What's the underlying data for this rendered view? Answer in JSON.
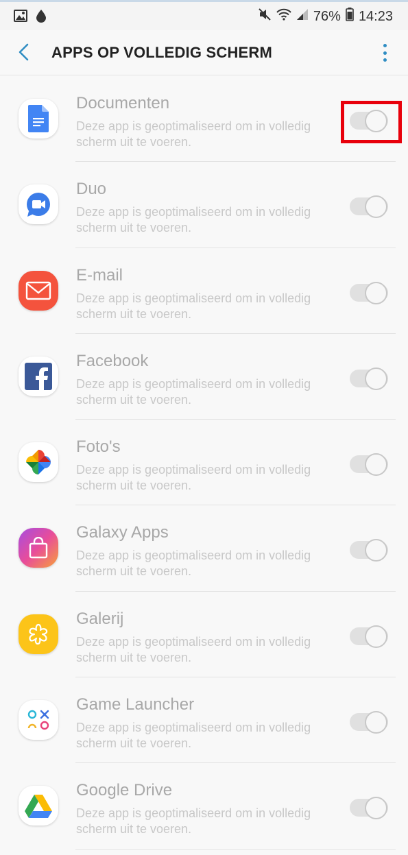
{
  "status_bar": {
    "battery": "76%",
    "time": "14:23",
    "icons": [
      "image-icon",
      "drop-icon",
      "mute-icon",
      "wifi-icon",
      "signal-icon",
      "battery-icon"
    ]
  },
  "app_bar": {
    "title": "APPS OP VOLLEDIG SCHERM",
    "back_icon": "back-arrow-icon",
    "more_icon": "more-vert-icon"
  },
  "colors": {
    "accent": "#2f8dc3",
    "highlight": "#e8000b",
    "disabled_title": "#a8a8a8",
    "disabled_desc": "#c8c8c8"
  },
  "apps": [
    {
      "name": "Documenten",
      "desc": "Deze app is geoptimaliseerd om in volledig scherm uit te voeren.",
      "icon": "docs-icon",
      "enabled": false
    },
    {
      "name": "Duo",
      "desc": "Deze app is geoptimaliseerd om in volledig scherm uit te voeren.",
      "icon": "duo-icon",
      "enabled": false
    },
    {
      "name": "E-mail",
      "desc": "Deze app is geoptimaliseerd om in volledig scherm uit te voeren.",
      "icon": "email-icon",
      "enabled": false
    },
    {
      "name": "Facebook",
      "desc": "Deze app is geoptimaliseerd om in volledig scherm uit te voeren.",
      "icon": "facebook-icon",
      "enabled": false
    },
    {
      "name": "Foto's",
      "desc": "Deze app is geoptimaliseerd om in volledig scherm uit te voeren.",
      "icon": "photos-icon",
      "enabled": false
    },
    {
      "name": "Galaxy Apps",
      "desc": "Deze app is geoptimaliseerd om in volledig scherm uit te voeren.",
      "icon": "galaxy-apps-icon",
      "enabled": false
    },
    {
      "name": "Galerij",
      "desc": "Deze app is geoptimaliseerd om in volledig scherm uit te voeren.",
      "icon": "gallery-icon",
      "enabled": false
    },
    {
      "name": "Game Launcher",
      "desc": "Deze app is geoptimaliseerd om in volledig scherm uit te voeren.",
      "icon": "game-launcher-icon",
      "enabled": false
    },
    {
      "name": "Google Drive",
      "desc": "Deze app is geoptimaliseerd om in volledig scherm uit te voeren.",
      "icon": "google-drive-icon",
      "enabled": false
    }
  ]
}
